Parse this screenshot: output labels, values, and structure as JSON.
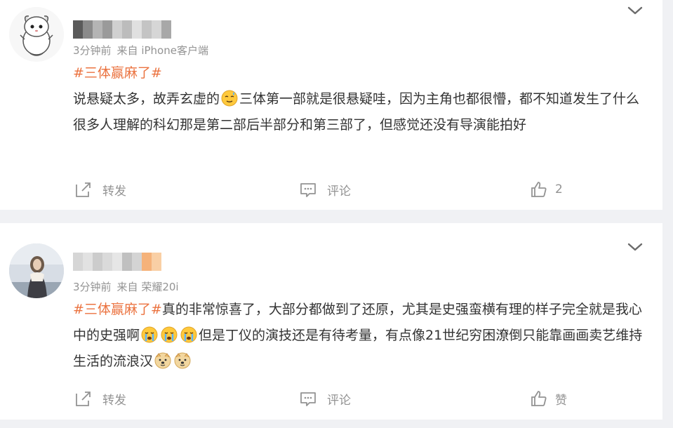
{
  "posts": [
    {
      "meta_time": "3分钟前",
      "meta_source": "来自 iPhone客户端",
      "topic": "#三体赢麻了#",
      "text_1": "说悬疑太多，故弄玄虚的",
      "text_2": "三体第一部就是很悬疑哇，因为主角也都很懵，都不知道发生了什么",
      "text_3": "很多人理解的科幻那是第二部后半部分和第三部了，但感觉还没有导演能拍好",
      "repost_label": "转发",
      "comment_label": "评论",
      "like_label": "2",
      "emoji": "sweat-smile-emoji"
    },
    {
      "meta_time": "3分钟前",
      "meta_source": "来自 荣耀20i",
      "topic": "#三体赢麻了#",
      "text_1": "真的非常惊喜了，大部分都做到了还原，尤其是史强蛮横有理的样子完全就是我心中的史强啊",
      "text_2": "但是丁仪的演技还是有待考量，有点像21世纪穷困潦倒只能靠画画卖艺维持生活的流浪汉",
      "repost_label": "转发",
      "comment_label": "评论",
      "like_label": "赞",
      "emoji": "crying-emoji",
      "emoji_2": "doge-emoji"
    }
  ],
  "colors": {
    "topic": "#eb7340",
    "meta": "#939393",
    "text": "#333333",
    "background": "#f0f1f4"
  }
}
